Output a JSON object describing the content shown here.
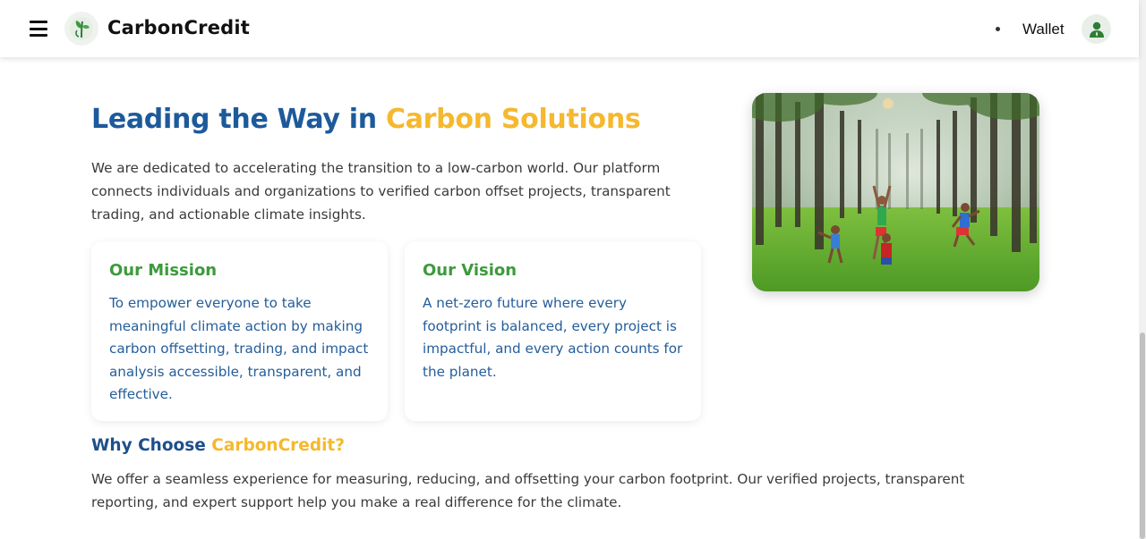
{
  "header": {
    "brand": "CarbonCredit",
    "wallet_label": "Wallet"
  },
  "hero": {
    "title_part1": "Leading the Way in",
    "title_part2": "Carbon Solutions",
    "intro": "We are dedicated to accelerating the transition to a low-carbon world. Our platform connects individuals and organizations to verified carbon offset projects, transparent trading, and actionable climate insights."
  },
  "mission": {
    "title": "Our Mission",
    "text": "To empower everyone to take meaningful climate action by making carbon offsetting, trading, and impact analysis accessible, transparent, and effective."
  },
  "vision": {
    "title": "Our Vision",
    "text": "A net-zero future where every footprint is balanced, every project is impactful, and every action counts for the planet."
  },
  "why": {
    "title_part1": "Why Choose",
    "title_part2": "CarbonCredit?",
    "text": "We offer a seamless experience for measuring, reducing, and offsetting your carbon footprint. Our verified projects, transparent reporting, and expert support help you make a real difference for the climate."
  },
  "colors": {
    "primary_blue": "#1d5a9b",
    "accent_yellow": "#f5b82e",
    "green": "#3d9a3d"
  },
  "icons": {
    "menu": "hamburger-menu-icon",
    "logo": "leaf-logo-icon",
    "avatar": "user-avatar-icon"
  }
}
